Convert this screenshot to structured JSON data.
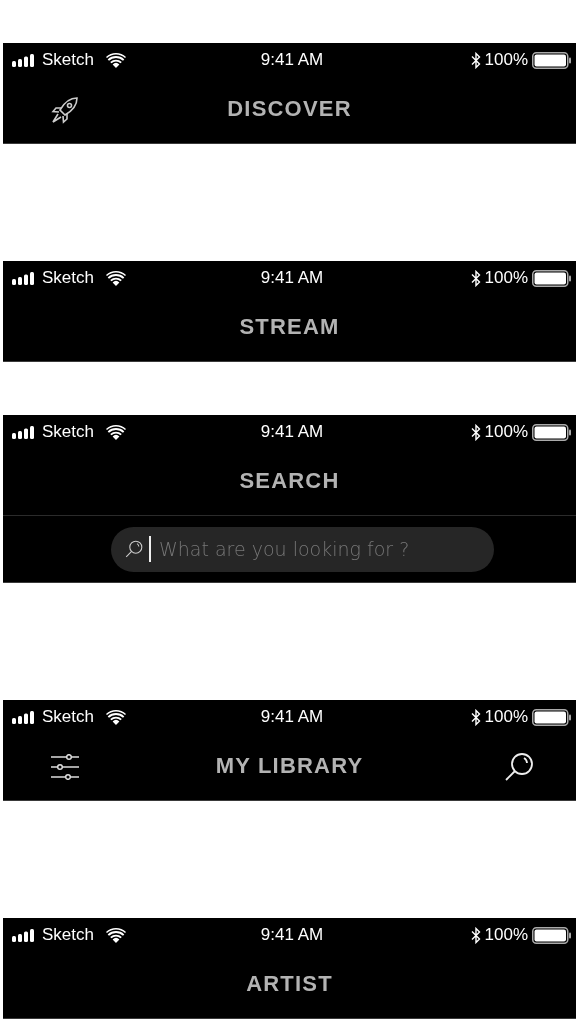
{
  "screens": [
    {
      "status_bar": {
        "carrier": "Sketch",
        "time": "9:41 AM",
        "battery": "100%"
      },
      "title": "DISCOVER",
      "left_button": {
        "kind": "rocket"
      }
    },
    {
      "status_bar": {
        "carrier": "Sketch",
        "time": "9:41 AM",
        "battery": "100%"
      },
      "title": "STREAM"
    },
    {
      "status_bar": {
        "carrier": "Sketch",
        "time": "9:41 AM",
        "battery": "100%"
      },
      "title": "SEARCH",
      "search": {
        "placeholder": "What are you looking for ?"
      }
    },
    {
      "status_bar": {
        "carrier": "Sketch",
        "time": "9:41 AM",
        "battery": "100%"
      },
      "title": "MY LIBRARY",
      "left_button": {
        "kind": "sliders"
      },
      "right_button": {
        "kind": "search"
      }
    },
    {
      "status_bar": {
        "carrier": "Sketch",
        "time": "9:41 AM",
        "battery": "100%"
      },
      "title": "ARTIST"
    }
  ]
}
